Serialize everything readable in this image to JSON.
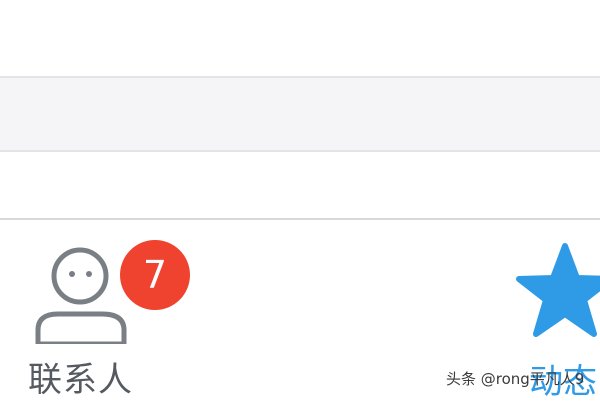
{
  "tabbar": {
    "contacts": {
      "label": "联系人",
      "badge_count": "7",
      "icon": "person-outline-icon",
      "label_color": "#555a60",
      "badge_color": "#f0432f"
    },
    "moments": {
      "label": "动态",
      "icon": "star-icon",
      "label_color": "#2f9be6"
    }
  },
  "watermark": "头条 @rong平凡人9"
}
